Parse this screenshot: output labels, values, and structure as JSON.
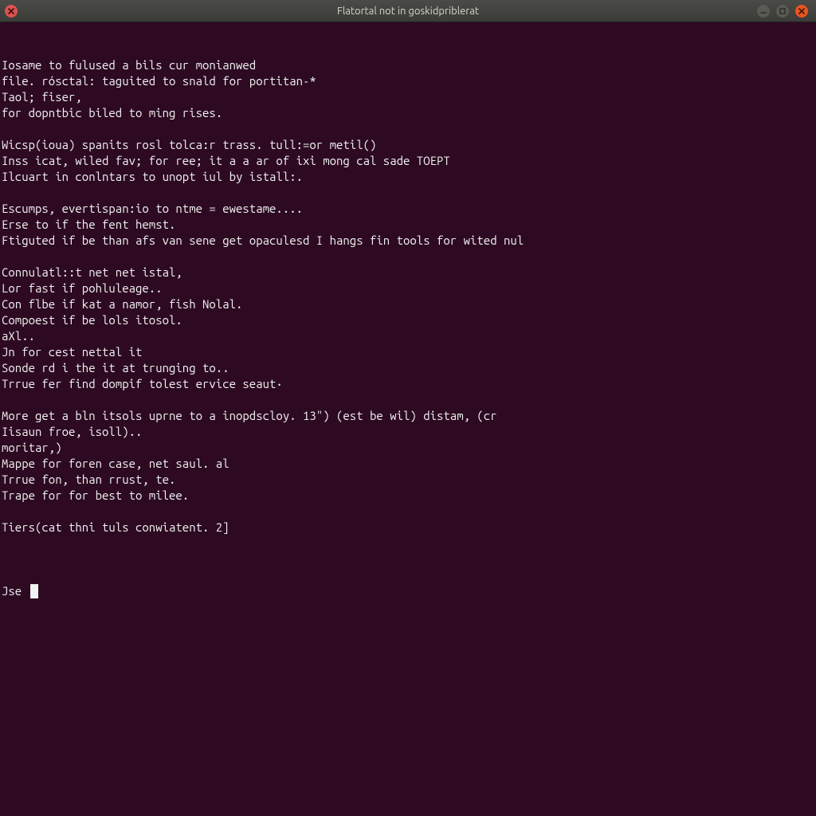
{
  "titlebar": {
    "title": "Flatortal not in goskidpriblerat"
  },
  "window_controls": {
    "close_left": {
      "name": "close-icon"
    },
    "minimize": {
      "name": "minimize-icon"
    },
    "maximize": {
      "name": "maximize-icon"
    },
    "close_right": {
      "name": "close-icon"
    }
  },
  "terminal": {
    "lines": [
      "Iosame to fulused a bils cur monianwed",
      "file. rósctal: taguited to snald for portitan-*",
      "Taol; fiser,",
      "for dopntbic biled to ming rises.",
      "",
      "Wicsp(ioua) spanits rosl tolca:r trass. tull:=or metil()",
      "Inss icat, wiled fav; for ree; it a a ar of ixi mong cal sade TOEPT",
      "Ilcuart in conlntars to unopt iul by istall:.",
      "",
      "Escumps, evertispan:io to ntme = ewestame....",
      "Erse to if the fent hemst.",
      "Ftiguted if be than afs van sene get opaculesd I hangs fin tools for wited nul",
      "",
      "Connulatl::t net net istal,",
      "Lor fast if pohluleage..",
      "Con flbe if kat a namor, fish Nolal.",
      "Compoest if be lols itosol.",
      "aXl..",
      "Jn for cest nettal it",
      "Sonde rd i the it at trunging to..",
      "Trrue fer find dompif tolest ervice seaut·",
      "",
      "More get a bln itsols uprne to a inopdscloy. 13\") (est be wil) distam, (cr",
      "Iisaun froe, isoll)..",
      "moritar,)",
      "Mappe for foren case, net saul. al",
      "Trrue fon, than rrust, te.",
      "Trape for for best to milee.",
      "",
      "Tiers(cat thni tuls conwiatent. 2]",
      ""
    ],
    "prompt": "Jse "
  },
  "colors": {
    "bg": "#2d0a22",
    "fg": "#f2f2f2",
    "titlebar_bg": "#3e3e3a",
    "close_orange": "#e95420"
  }
}
